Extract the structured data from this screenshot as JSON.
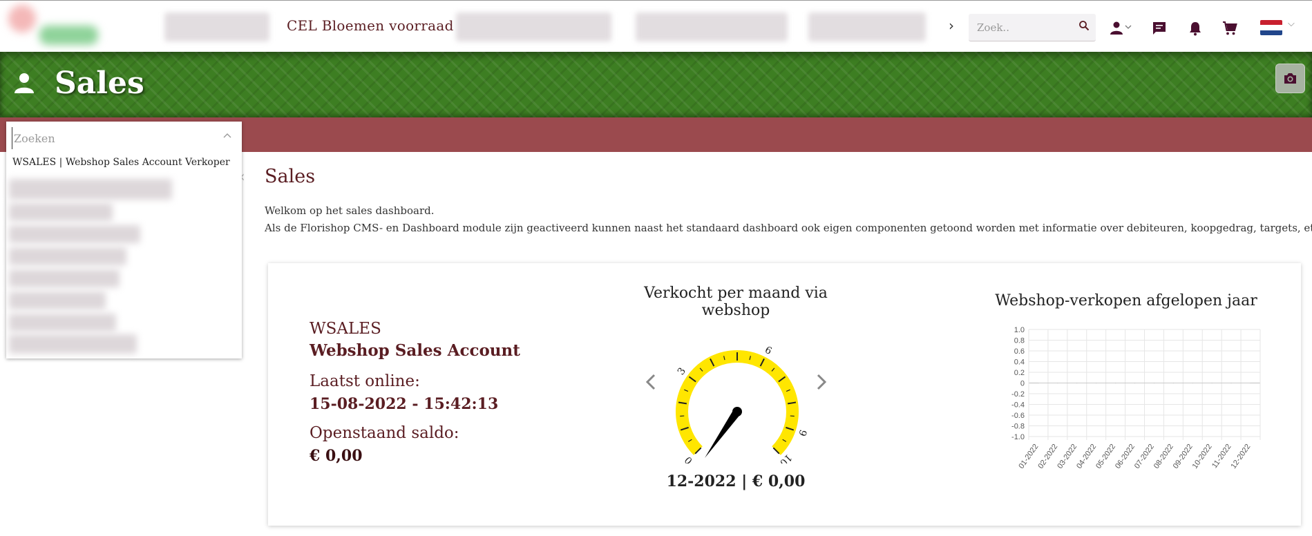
{
  "nav": {
    "active_link": "CEL Bloemen voorraad",
    "more_chevron": "›",
    "search_placeholder": "Zoek.."
  },
  "banner": {
    "title": "Sales"
  },
  "dropdown": {
    "placeholder": "Zoeken",
    "selected_item": "WSALES | Webshop Sales Account Verkoper"
  },
  "page": {
    "title": "Sales",
    "intro_line1": "Welkom op het sales dashboard.",
    "intro_line2": "Als de Florishop CMS- en Dashboard module zijn geactiveerd kunnen naast het standaard dashboard ook eigen componenten getoond worden met informatie over debiteuren, koopgedrag, targets, etc."
  },
  "account": {
    "code": "WSALES",
    "name": "Webshop Sales Account",
    "last_online_label": "Laatst online:",
    "last_online_value": "15-08-2022 - 15:42:13",
    "balance_label": "Openstaand saldo:",
    "balance_value": "€ 0,00"
  },
  "gauge": {
    "title": "Verkocht per maand via webshop",
    "value_label": "12-2022 | € 0,00",
    "min": 0,
    "max": 10,
    "value": 0,
    "tick_labels": [
      "0",
      "3",
      "6",
      "9",
      "10"
    ],
    "arc_color": "#ffe600",
    "needle_color": "#000000"
  },
  "chart_data": {
    "type": "line",
    "title": "Webshop-verkopen afgelopen jaar",
    "categories": [
      "01-2022",
      "02-2022",
      "03-2022",
      "04-2022",
      "05-2022",
      "06-2022",
      "07-2022",
      "08-2022",
      "09-2022",
      "10-2022",
      "11-2022",
      "12-2022"
    ],
    "series": [
      {
        "values": [
          0,
          0,
          0,
          0,
          0,
          0,
          0,
          0,
          0,
          0,
          0,
          0
        ]
      }
    ],
    "ylim": [
      -1.0,
      1.0
    ],
    "y_ticks": [
      "1.0",
      "0.8",
      "0.6",
      "0.4",
      "0.2",
      "0",
      "-0.2",
      "-0.4",
      "-0.6",
      "-0.8",
      "-1.0"
    ],
    "grid": true,
    "xlabel": "",
    "ylabel": ""
  },
  "colors": {
    "brand_text": "#5a1d22",
    "banner_green": "#3d7e22",
    "strip_maroon": "#9b4a4e"
  }
}
